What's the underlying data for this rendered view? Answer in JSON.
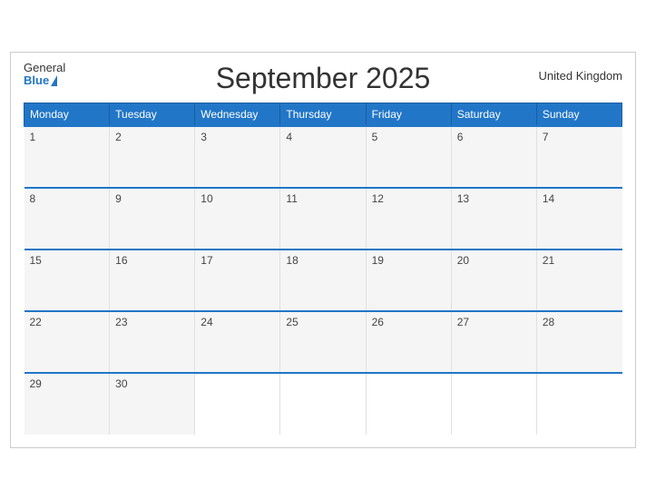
{
  "header": {
    "title": "September 2025",
    "region": "United Kingdom",
    "logo_general": "General",
    "logo_blue": "Blue"
  },
  "days_of_week": [
    "Monday",
    "Tuesday",
    "Wednesday",
    "Thursday",
    "Friday",
    "Saturday",
    "Sunday"
  ],
  "weeks": [
    [
      "1",
      "2",
      "3",
      "4",
      "5",
      "6",
      "7"
    ],
    [
      "8",
      "9",
      "10",
      "11",
      "12",
      "13",
      "14"
    ],
    [
      "15",
      "16",
      "17",
      "18",
      "19",
      "20",
      "21"
    ],
    [
      "22",
      "23",
      "24",
      "25",
      "26",
      "27",
      "28"
    ],
    [
      "29",
      "30",
      "",
      "",
      "",
      "",
      ""
    ]
  ]
}
